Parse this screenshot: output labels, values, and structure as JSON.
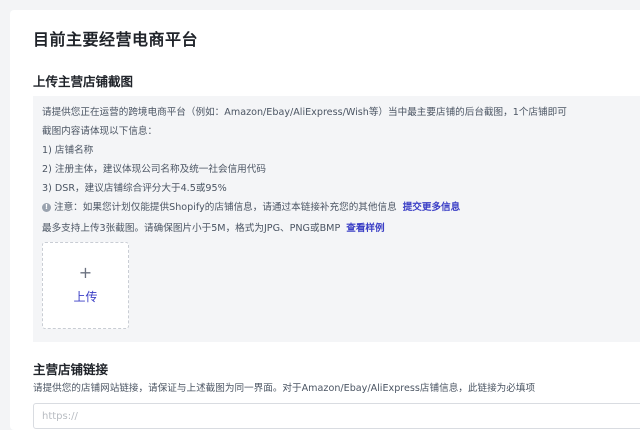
{
  "page": {
    "title": "目前主要经营电商平台"
  },
  "upload_section": {
    "title": "上传主营店铺截图",
    "instructions": [
      "请提供您正在运营的跨境电商平台（例如：Amazon/Ebay/AliExpress/Wish等）当中最主要店铺的后台截图，1个店铺即可",
      "截图内容请体现以下信息：",
      "1) 店铺名称",
      "2) 注册主体，建议体现公司名称及统一社会信用代码",
      "3) DSR，建议店铺综合评分大于4.5或95%"
    ],
    "note": {
      "icon": "info-icon",
      "text": "注意：如果您计划仅能提供Shopify的店铺信息，请通过本链接补充您的其他信息",
      "link": "提交更多信息"
    },
    "limit": {
      "text": "最多支持上传3张截图。请确保图片小于5M，格式为JPG、PNG或BMP",
      "link": "查看样例"
    },
    "upload_button": {
      "icon": "plus-icon",
      "label": "上传"
    }
  },
  "link_section": {
    "title": "主营店铺链接",
    "description": "请提供您的店铺网站链接，请保证与上述截图为同一界面。对于Amazon/Ebay/AliExpress店铺信息，此链接为必填项",
    "input": {
      "placeholder": "https://",
      "value": ""
    }
  },
  "colors": {
    "accent": "#3b3fc6",
    "panel_bg": "#f4f5f7",
    "page_bg": "#f3f4f6",
    "text": "#4b5563"
  }
}
